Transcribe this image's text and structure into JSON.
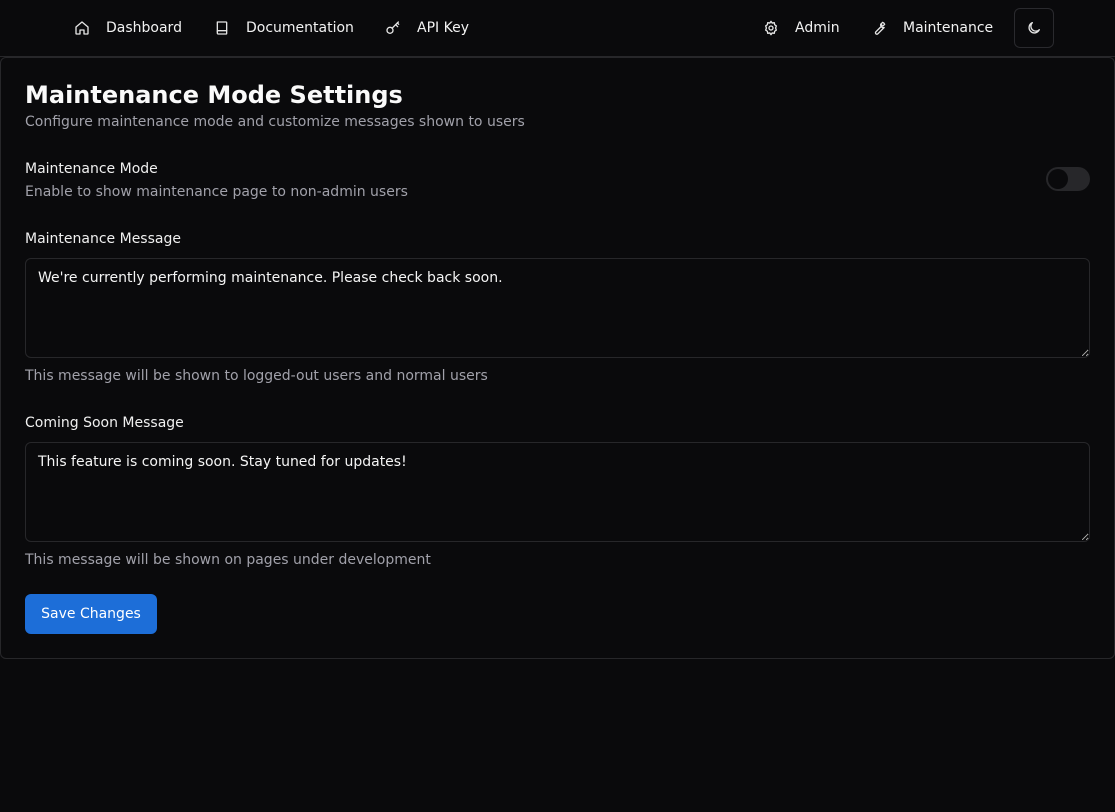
{
  "nav": {
    "dashboard": "Dashboard",
    "documentation": "Documentation",
    "api_key": "API Key",
    "admin": "Admin",
    "maintenance": "Maintenance"
  },
  "page": {
    "title": "Maintenance Mode Settings",
    "subtitle": "Configure maintenance mode and customize messages shown to users"
  },
  "maintenance_mode": {
    "label": "Maintenance Mode",
    "description": "Enable to show maintenance page to non-admin users",
    "enabled": false
  },
  "maintenance_message": {
    "label": "Maintenance Message",
    "value": "We're currently performing maintenance. Please check back soon.",
    "help": "This message will be shown to logged-out users and normal users"
  },
  "coming_soon_message": {
    "label": "Coming Soon Message",
    "value": "This feature is coming soon. Stay tuned for updates!",
    "help": "This message will be shown on pages under development"
  },
  "actions": {
    "save_label": "Save Changes"
  },
  "colors": {
    "background": "#0a0a0c",
    "accent": "#1d6ed8",
    "border": "#27272a",
    "muted_text": "#a1a1aa"
  },
  "icons": {
    "dashboard": "home-icon",
    "documentation": "book-icon",
    "api_key": "key-icon",
    "admin": "gear-icon",
    "maintenance": "wrench-icon",
    "theme": "moon-icon"
  }
}
